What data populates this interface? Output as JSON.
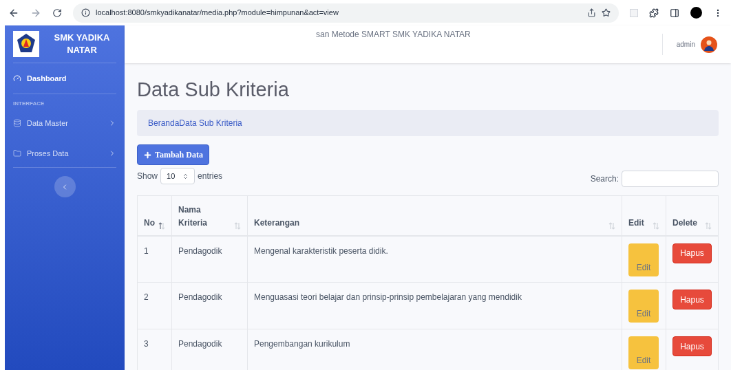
{
  "browser": {
    "url": "localhost:8080/smkyadikanatar/media.php?module=himpunan&act=view"
  },
  "sidebar": {
    "brand": "SMK YADIKA NATAR",
    "heading": "INTERFACE",
    "items": [
      {
        "label": "Dashboard",
        "kind": "dashboard",
        "selected": true,
        "submenu": false
      },
      {
        "label": "Data Master",
        "kind": "database",
        "selected": false,
        "submenu": true
      },
      {
        "label": "Proses Data",
        "kind": "folder",
        "selected": false,
        "submenu": true
      }
    ]
  },
  "topbar": {
    "title": "san Metode SMART SMK YADIKA NATAR",
    "user": "admin"
  },
  "page": {
    "title": "Data Sub Kriteria",
    "breadcrumb": "BerandaData Sub Kriteria",
    "add_button": "Tambah Data"
  },
  "table_controls": {
    "show": "Show",
    "page_size": "10",
    "entries": "entries",
    "search_label": "Search:"
  },
  "table": {
    "columns": [
      {
        "label": "No",
        "sorted": true
      },
      {
        "label": "Nama Kriteria",
        "sorted": false
      },
      {
        "label": "Keterangan",
        "sorted": false
      },
      {
        "label": "Edit",
        "sorted": false
      },
      {
        "label": "Delete",
        "sorted": false
      }
    ],
    "rows": [
      {
        "no": "1",
        "kriteria": "Pendagodik",
        "keterangan": "Mengenal karakteristik peserta didik.",
        "edit": "Edit",
        "delete": "Hapus"
      },
      {
        "no": "2",
        "kriteria": "Pendagodik",
        "keterangan": "Menguasasi teori belajar dan prinsip-prinsip pembelajaran yang mendidik",
        "edit": "Edit",
        "delete": "Hapus"
      },
      {
        "no": "3",
        "kriteria": "Pendagodik",
        "keterangan": "Pengembangan kurikulum",
        "edit": "Edit",
        "delete": "Hapus"
      }
    ]
  }
}
